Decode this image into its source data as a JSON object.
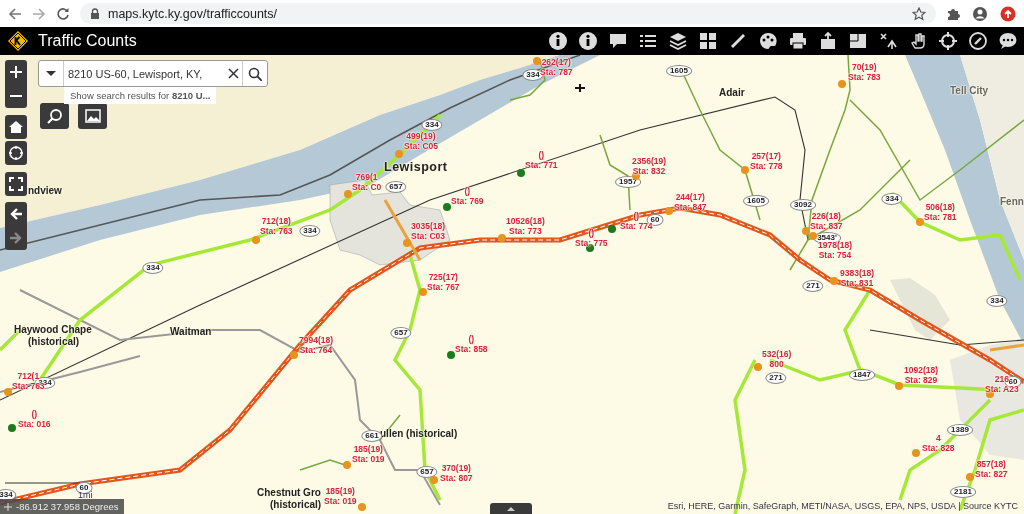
{
  "browser": {
    "url": "maps.kytc.ky.gov/trafficcounts/"
  },
  "header": {
    "title": "Traffic Counts"
  },
  "search": {
    "value": "8210 US-60, Lewisport, KY,",
    "suggestion": "Show search results for **8210 U...**"
  },
  "places": [
    {
      "name": "Lewisport",
      "kind": "town"
    },
    {
      "name": "Adair",
      "kind": "place"
    },
    {
      "name": "Tell City",
      "kind": "faded"
    },
    {
      "name": "Fenn",
      "kind": "faded"
    },
    {
      "name": "ndview",
      "kind": "place"
    },
    {
      "name": "Haywood Chape",
      "kind": "place"
    },
    {
      "name": "(historical)",
      "kind": "place"
    },
    {
      "name": "Waitman",
      "kind": "place"
    },
    {
      "name": "ullen (historical)",
      "kind": "place"
    },
    {
      "name": "Chestnut Gro",
      "kind": "place"
    },
    {
      "name": "(historical)",
      "kind": "place"
    }
  ],
  "shields": [
    "334",
    "1605",
    "334",
    "657",
    "334",
    "334",
    "1957",
    "60",
    "1605",
    "3092",
    "3543'",
    "334",
    "271",
    "657",
    "334",
    "1847",
    "271",
    "60",
    "1389",
    "2181",
    "661",
    "657",
    "60",
    "334",
    "334"
  ],
  "stations": [
    {
      "count": "262(17)",
      "station": "Sta: 787",
      "color": "#e8931e"
    },
    {
      "count": "70(19)",
      "station": "Sta: 783",
      "color": "#e8931e"
    },
    {
      "count": "499(19)",
      "station": "Sta: C05",
      "color": "#e8931e"
    },
    {
      "count": "()",
      "station": "Sta: 771",
      "color": "#1d7a1d"
    },
    {
      "count": "2356(19)",
      "station": "Sta: 832",
      "color": "#e8931e"
    },
    {
      "count": "257(17)",
      "station": "Sta: 778",
      "color": "#e8931e"
    },
    {
      "count": "769(1",
      "station": "Sta: C0",
      "color": "#e8931e"
    },
    {
      "count": "()",
      "station": "Sta: 769",
      "color": "#1d7a1d"
    },
    {
      "count": "712(18)",
      "station": "Sta: 763",
      "color": "#e8931e"
    },
    {
      "count": "3035(18)",
      "station": "Sta: C03",
      "color": "#e8931e"
    },
    {
      "count": "10526(18)",
      "station": "Sta: 773",
      "color": "#e8931e"
    },
    {
      "count": "()",
      "station": "Sta: 775",
      "color": "#1d7a1d"
    },
    {
      "count": "()",
      "station": "Sta: 774",
      "color": "#1d7a1d"
    },
    {
      "count": "244(17)",
      "station": "Sta: 847",
      "color": "#e8931e"
    },
    {
      "count": "226(18)",
      "station": "Sta: 837",
      "color": "#e8931e"
    },
    {
      "count": "1978(18)",
      "station": "Sta: 754",
      "color": "#e8931e"
    },
    {
      "count": "506(18)",
      "station": "Sta: 781",
      "color": "#e8931e"
    },
    {
      "count": "725(17)",
      "station": "Sta: 767",
      "color": "#e8931e"
    },
    {
      "count": "9383(18)",
      "station": "Sta: 831",
      "color": "#e8931e"
    },
    {
      "count": "7994(18)",
      "station": "Sta: 764",
      "color": "#e8931e"
    },
    {
      "count": "()",
      "station": "Sta: 858",
      "color": "#1d7a1d"
    },
    {
      "count": "712(1",
      "station": "Sta: 763",
      "color": "#e8931e"
    },
    {
      "count": "()",
      "station": "Sta: 016",
      "color": "#1d7a1d"
    },
    {
      "count": "532(16)",
      "station": "800",
      "color": "#e8931e"
    },
    {
      "count": "1092(18)",
      "station": "Sta: 829",
      "color": "#e8931e"
    },
    {
      "count": "216",
      "station": "Sta: A23",
      "color": "#e8931e"
    },
    {
      "count": "4",
      "station": "Sta: 828",
      "color": "#e8931e"
    },
    {
      "count": "857(18)",
      "station": "Sta: 827",
      "color": "#e8931e"
    },
    {
      "count": "185(19)",
      "station": "Sta: 019",
      "color": "#e8931e"
    },
    {
      "count": "370(19)",
      "station": "Sta: 807",
      "color": "#e8931e"
    },
    {
      "count": "185(19)",
      "station": "Sta: 019",
      "color": "#e8931e"
    }
  ],
  "scale": "1mi",
  "coordinates": "-86.912 37.958 Degrees",
  "attribution": "Esri, HERE, Garmin, SafeGraph, METI/NASA, USGS, EPA, NPS, USDA | Source KYTC"
}
